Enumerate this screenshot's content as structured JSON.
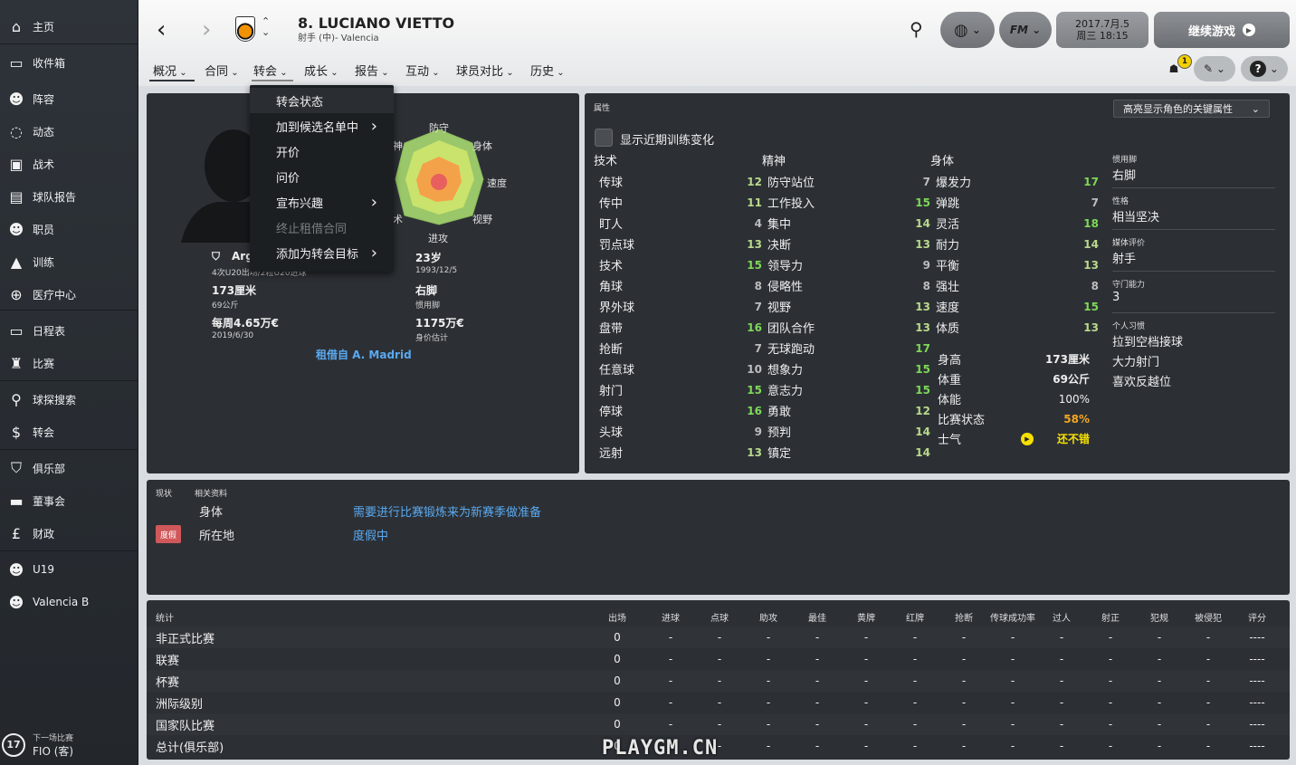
{
  "sidebar": {
    "items": [
      {
        "label": "主页",
        "icon": "home-icon"
      },
      {
        "label": "收件箱",
        "icon": "inbox-icon"
      },
      {
        "label": "阵容",
        "icon": "squad-icon"
      },
      {
        "label": "动态",
        "icon": "dynamics-icon"
      },
      {
        "label": "战术",
        "icon": "tactics-icon"
      },
      {
        "label": "球队报告",
        "icon": "report-icon"
      },
      {
        "label": "职员",
        "icon": "staff-icon"
      },
      {
        "label": "训练",
        "icon": "training-icon"
      },
      {
        "label": "医疗中心",
        "icon": "medical-icon"
      },
      {
        "label": "日程表",
        "icon": "calendar-icon"
      },
      {
        "label": "比赛",
        "icon": "trophy-icon"
      },
      {
        "label": "球探搜索",
        "icon": "search-icon"
      },
      {
        "label": "转会",
        "icon": "transfer-icon"
      },
      {
        "label": "俱乐部",
        "icon": "club-icon"
      },
      {
        "label": "董事会",
        "icon": "board-icon"
      },
      {
        "label": "财政",
        "icon": "finance-icon"
      },
      {
        "label": "U19",
        "icon": "u19-icon"
      },
      {
        "label": "Valencia B",
        "icon": "b-team-icon"
      }
    ],
    "next_match": {
      "caption": "下一场比赛",
      "day": "17",
      "opponent": "FIO (客)"
    }
  },
  "header": {
    "player_name": "8. LUCIANO VIETTO",
    "player_sub": "射手 (中)- Valencia",
    "date_line1": "2017.7月.5",
    "date_line2": "周三 18:15",
    "continue_label": "继续游戏",
    "fm_label": "FM",
    "badge_count": "1"
  },
  "tabs": [
    "概况",
    "合同",
    "转会",
    "成长",
    "报告",
    "互动",
    "球员对比",
    "历史"
  ],
  "dropdown": [
    {
      "label": "转会状态",
      "arrow": false,
      "disabled": false
    },
    {
      "label": "加到候选名单中",
      "arrow": true,
      "disabled": false
    },
    {
      "label": "开价",
      "arrow": false,
      "disabled": false
    },
    {
      "label": "问价",
      "arrow": false,
      "disabled": false
    },
    {
      "label": "宣布兴趣",
      "arrow": true,
      "disabled": false
    },
    {
      "label": "终止租借合同",
      "arrow": false,
      "disabled": true
    },
    {
      "label": "添加为转会目标",
      "arrow": true,
      "disabled": false
    }
  ],
  "profile": {
    "radar_labels": {
      "top": "防守",
      "tr": "身体",
      "right": "速度",
      "br": "视野",
      "bottom": "进攻",
      "bl": "技术",
      "left": "精神"
    },
    "partial_left": {
      "l1": "神",
      "l2": "耐空",
      "l3": "术"
    },
    "nation_partial": "Arg",
    "nation_caps": "4次U20出场/2粒U20进球",
    "height": "173厘米",
    "weight": "69公斤",
    "wage": "每周4.65万€",
    "contract": "2019/6/30",
    "age": "23岁",
    "dob": "1993/12/5",
    "foot": "右脚",
    "foot_label": "惯用脚",
    "value": "1175万€",
    "value_label": "身价估计",
    "loan": "租借自 A. Madrid"
  },
  "attributes": {
    "title": "属性",
    "highlight": "高亮显示角色的关键属性",
    "training_toggle": "显示近期训练变化",
    "technical": {
      "header": "技术",
      "rows": [
        [
          "传球",
          "12"
        ],
        [
          "传中",
          "11"
        ],
        [
          "盯人",
          "4"
        ],
        [
          "罚点球",
          "13"
        ],
        [
          "技术",
          "15"
        ],
        [
          "角球",
          "8"
        ],
        [
          "界外球",
          "7"
        ],
        [
          "盘带",
          "16"
        ],
        [
          "抢断",
          "7"
        ],
        [
          "任意球",
          "10"
        ],
        [
          "射门",
          "15"
        ],
        [
          "停球",
          "16"
        ],
        [
          "头球",
          "9"
        ],
        [
          "远射",
          "13"
        ]
      ]
    },
    "mental": {
      "header": "精神",
      "rows": [
        [
          "防守站位",
          "7"
        ],
        [
          "工作投入",
          "15"
        ],
        [
          "集中",
          "14"
        ],
        [
          "决断",
          "13"
        ],
        [
          "领导力",
          "9"
        ],
        [
          "侵略性",
          "8"
        ],
        [
          "视野",
          "13"
        ],
        [
          "团队合作",
          "13"
        ],
        [
          "无球跑动",
          "17"
        ],
        [
          "想象力",
          "15"
        ],
        [
          "意志力",
          "15"
        ],
        [
          "勇敢",
          "12"
        ],
        [
          "预判",
          "14"
        ],
        [
          "镇定",
          "14"
        ]
      ]
    },
    "physical": {
      "header": "身体",
      "rows": [
        [
          "爆发力",
          "17"
        ],
        [
          "弹跳",
          "7"
        ],
        [
          "灵活",
          "18"
        ],
        [
          "耐力",
          "14"
        ],
        [
          "平衡",
          "13"
        ],
        [
          "强壮",
          "8"
        ],
        [
          "速度",
          "15"
        ],
        [
          "体质",
          "13"
        ]
      ]
    },
    "extra": [
      [
        "身高",
        "173厘米"
      ],
      [
        "体重",
        "69公斤"
      ],
      [
        "体能",
        "100%"
      ],
      [
        "比赛状态",
        "58%"
      ],
      [
        "士气",
        "还不错"
      ]
    ],
    "side": [
      {
        "h": "惯用脚",
        "v": [
          "右脚"
        ]
      },
      {
        "h": "性格",
        "v": [
          "相当坚决"
        ]
      },
      {
        "h": "媒体评价",
        "v": [
          "射手"
        ]
      },
      {
        "h": "守门能力",
        "v": [
          "3"
        ]
      },
      {
        "h": "个人习惯",
        "v": [
          "拉到空档接球",
          "大力射门",
          "喜欢反越位"
        ]
      }
    ],
    "colors": {
      "high": "#7ed957",
      "mid": "#b8d98a",
      "low": "#bdbdbd",
      "form": "#f5a623",
      "morale": "#f7e000"
    }
  },
  "status": {
    "tab1": "现状",
    "tab2": "相关资料",
    "badge": "度假",
    "rows": [
      [
        "身体",
        "需要进行比赛锻炼来为新赛季做准备"
      ],
      [
        "所在地",
        "度假中"
      ]
    ]
  },
  "stats": {
    "title": "统计",
    "headers": [
      "出场",
      "进球",
      "点球",
      "助攻",
      "最佳",
      "黄牌",
      "红牌",
      "抢断",
      "传球成功率",
      "过人",
      "射正",
      "犯规",
      "被侵犯",
      "评分"
    ],
    "rows": [
      {
        "label": "非正式比赛",
        "vals": [
          "0",
          "-",
          "-",
          "-",
          "-",
          "-",
          "-",
          "-",
          "-",
          "-",
          "-",
          "-",
          "-",
          "----"
        ]
      },
      {
        "label": "联赛",
        "vals": [
          "0",
          "-",
          "-",
          "-",
          "-",
          "-",
          "-",
          "-",
          "-",
          "-",
          "-",
          "-",
          "-",
          "----"
        ]
      },
      {
        "label": "杯赛",
        "vals": [
          "0",
          "-",
          "-",
          "-",
          "-",
          "-",
          "-",
          "-",
          "-",
          "-",
          "-",
          "-",
          "-",
          "----"
        ]
      },
      {
        "label": "洲际级别",
        "vals": [
          "0",
          "-",
          "-",
          "-",
          "-",
          "-",
          "-",
          "-",
          "-",
          "-",
          "-",
          "-",
          "-",
          "----"
        ]
      },
      {
        "label": "国家队比赛",
        "vals": [
          "0",
          "-",
          "-",
          "-",
          "-",
          "-",
          "-",
          "-",
          "-",
          "-",
          "-",
          "-",
          "-",
          "----"
        ]
      },
      {
        "label": "总计(俱乐部)",
        "vals": [
          "0",
          "-",
          "-",
          "-",
          "-",
          "-",
          "-",
          "-",
          "-",
          "-",
          "-",
          "-",
          "-",
          "----"
        ]
      }
    ]
  },
  "watermark": "PLAYGM.CN"
}
